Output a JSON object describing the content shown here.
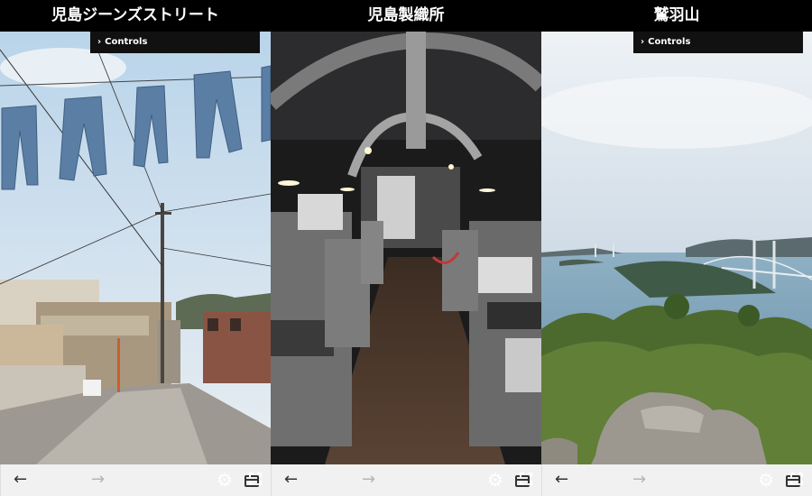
{
  "panels": [
    {
      "title": "児島ジーンズストリート",
      "controls_label": "Controls"
    },
    {
      "title": "児島製織所"
    },
    {
      "title": "鷲羽山",
      "controls_label": "Controls"
    }
  ],
  "icons": {
    "chevron": "chevron-right-icon",
    "settings": "gear-icon",
    "fullscreen": "fullscreen-icon",
    "back": "arrow-left-icon",
    "forward": "arrow-right-icon",
    "tabs": "browser-window-icon"
  },
  "glyphs": {
    "chevron": "›",
    "gear": "⚙",
    "back": "←",
    "forward": "→"
  },
  "colors": {
    "forward_disabled": "#b5b5b5",
    "nav_bg": "#f1f1f1"
  }
}
